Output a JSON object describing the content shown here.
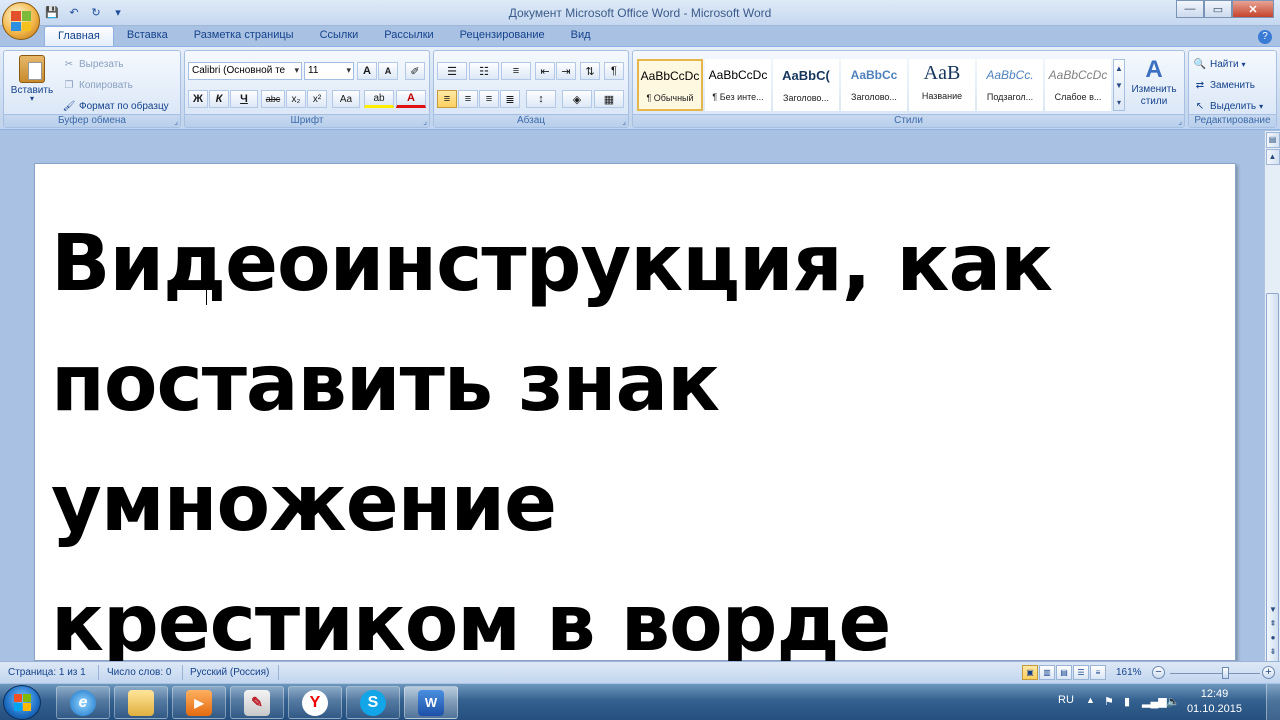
{
  "app": {
    "title": "Документ Microsoft Office Word - Microsoft Word",
    "help_glyph": "?"
  },
  "qat": {
    "save_icon": "save-icon",
    "undo_icon": "undo-icon",
    "redo_icon": "redo-icon",
    "customize_icon": "chevron-down-icon"
  },
  "window_controls": {
    "minimize": "—",
    "maximize": "▭",
    "close": "✕"
  },
  "tabs": [
    "Главная",
    "Вставка",
    "Разметка страницы",
    "Ссылки",
    "Рассылки",
    "Рецензирование",
    "Вид"
  ],
  "ribbon": {
    "clipboard": {
      "label": "Буфер обмена",
      "paste": "Вставить",
      "cut": "Вырезать",
      "copy": "Копировать",
      "format_painter": "Формат по образцу"
    },
    "font": {
      "label": "Шрифт",
      "font_name": "Calibri (Основной те",
      "font_size": "11",
      "grow": "A",
      "shrink": "A",
      "clear": "✐",
      "bold": "Ж",
      "italic": "К",
      "underline": "Ч",
      "strike": "abc",
      "subscript": "x₂",
      "superscript": "x²",
      "change_case": "Aa",
      "highlight": "ab",
      "font_color": "A"
    },
    "paragraph": {
      "label": "Абзац",
      "pilcrow": "¶"
    },
    "styles": {
      "label": "Стили",
      "items": [
        {
          "sample": "AaBbCcDc",
          "name": "¶ Обычный"
        },
        {
          "sample": "AaBbCcDc",
          "name": "¶ Без инте..."
        },
        {
          "sample": "AaBbC(",
          "name": "Заголово..."
        },
        {
          "sample": "AaBbCc",
          "name": "Заголово..."
        },
        {
          "sample": "AaB",
          "name": "Название"
        },
        {
          "sample": "AaBbCc.",
          "name": "Подзагол..."
        },
        {
          "sample": "AaBbCcDc",
          "name": "Слабое в..."
        }
      ],
      "change_styles_line1": "Изменить",
      "change_styles_line2": "стили"
    },
    "editing": {
      "label": "Редактирование",
      "find": "Найти",
      "replace": "Заменить",
      "select": "Выделить"
    }
  },
  "document": {
    "lines": [
      "Видеоинструкция, как",
      "поставить знак умножение",
      "крестиком в ворде"
    ]
  },
  "statusbar": {
    "page": "Страница: 1 из 1",
    "words": "Число слов: 0",
    "language": "Русский (Россия)",
    "zoom": "161%",
    "zoom_level_fraction": 0.62
  },
  "taskbar": {
    "apps": [
      "ie-icon",
      "explorer-icon",
      "media-player-icon",
      "pen-tool-icon",
      "yandex-icon",
      "skype-icon",
      "word-icon"
    ],
    "yandex_glyph": "Y",
    "skype_glyph": "S",
    "word_glyph": "W",
    "lang": "RU",
    "time": "12:49",
    "date": "01.10.2015"
  }
}
